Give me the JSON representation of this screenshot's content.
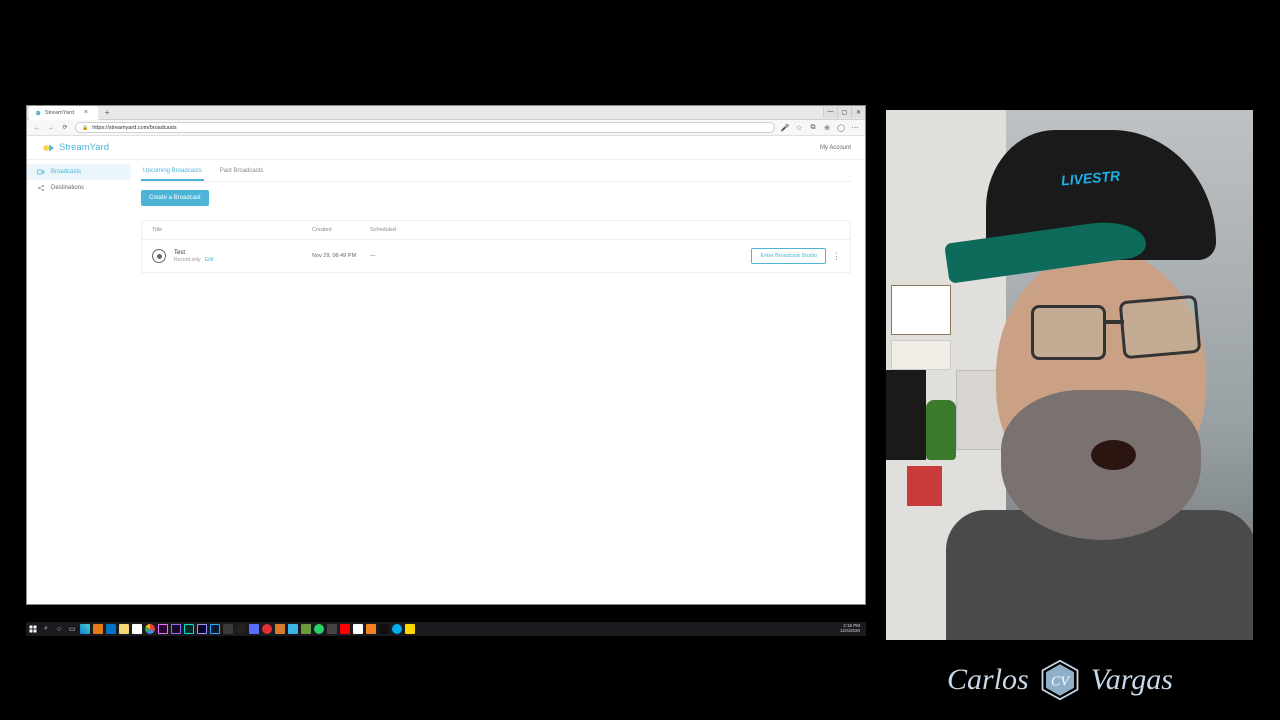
{
  "browser": {
    "tab_title": "StreamYard",
    "url": "https://streamyard.com/broadcasts",
    "window_controls": {
      "min": "—",
      "max": "▢",
      "close": "✕"
    }
  },
  "header": {
    "brand": "StreamYard",
    "account_link": "My Account"
  },
  "sidebar": {
    "items": [
      {
        "label": "Broadcasts"
      },
      {
        "label": "Destinations"
      }
    ]
  },
  "tabs": {
    "upcoming": "Upcoming Broadcasts",
    "past": "Past Broadcasts"
  },
  "buttons": {
    "create": "Create a Broadcast",
    "enter": "Enter Broadcast Studio"
  },
  "table": {
    "headers": {
      "title": "Title",
      "created": "Created",
      "scheduled": "Scheduled"
    },
    "rows": [
      {
        "title": "Test",
        "subtitle": "Record only",
        "edit": "Edit",
        "created": "Nov 29, 06:49 PM",
        "scheduled": "—"
      }
    ]
  },
  "taskbar": {
    "time": "2:15 PM",
    "date": "12/4/2020"
  },
  "signature": {
    "first": "Carlos",
    "last": "Vargas",
    "monogram": "CV"
  },
  "webcam": {
    "cap_text": "LIVESTR"
  }
}
